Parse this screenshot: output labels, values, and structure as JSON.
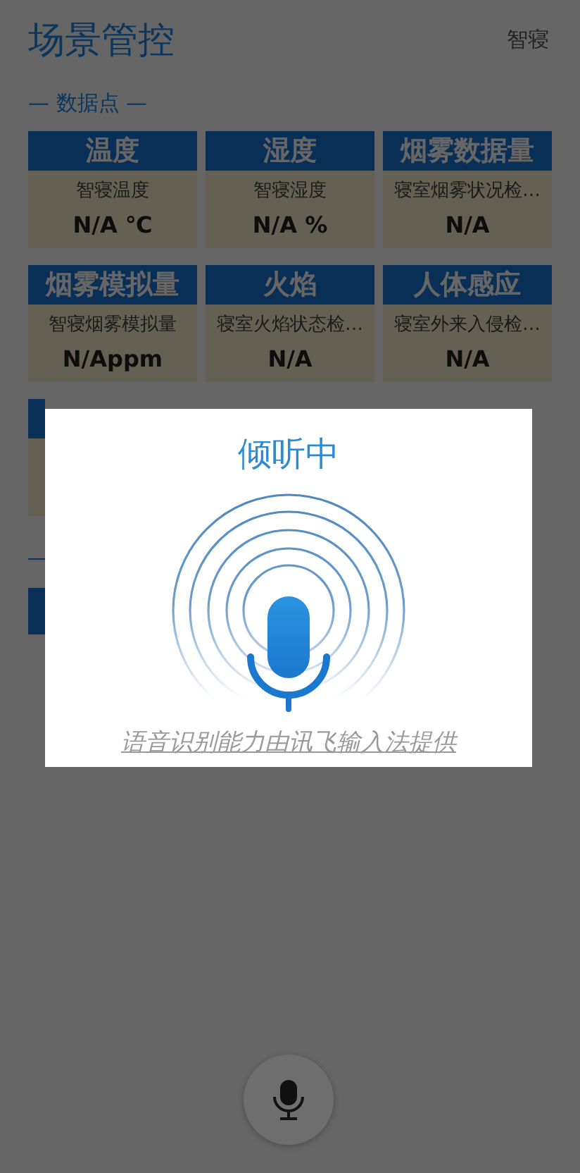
{
  "header": {
    "title": "场景管控",
    "subtitle": "智寝"
  },
  "section": {
    "title": "— 数据点 —"
  },
  "cards": [
    {
      "title": "温度",
      "label": "智寝温度",
      "value": "N/A ℃"
    },
    {
      "title": "湿度",
      "label": "智寝湿度",
      "value": "N/A %"
    },
    {
      "title": "烟雾数据量",
      "label": "寝室烟雾状况检…",
      "value": "N/A"
    },
    {
      "title": "烟雾模拟量",
      "label": "智寝烟雾模拟量",
      "value": "N/Appm"
    },
    {
      "title": "火焰",
      "label": "寝室火焰状态检…",
      "value": "N/A"
    },
    {
      "title": "人体感应",
      "label": "寝室外来入侵检…",
      "value": "N/A"
    }
  ],
  "dialog": {
    "title": "倾听中",
    "footer": "语音识别能力由讯飞输入法提供"
  }
}
